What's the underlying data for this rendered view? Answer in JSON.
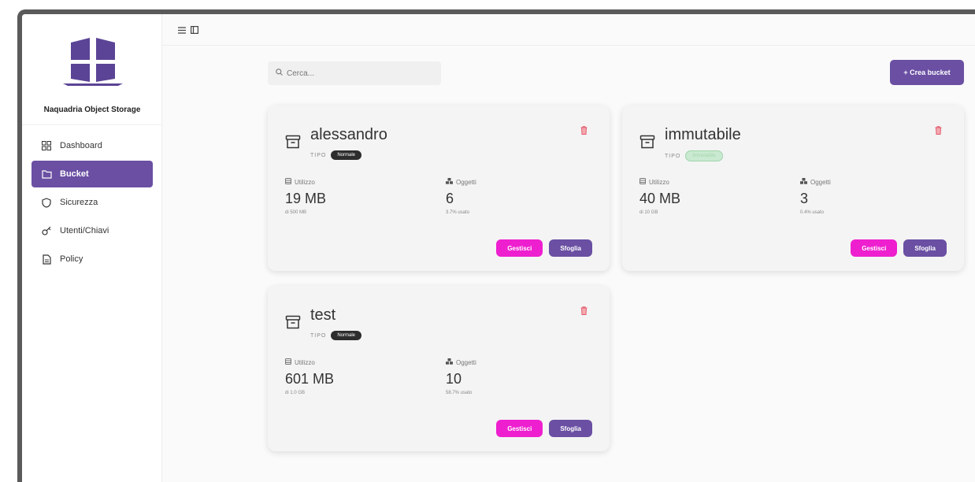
{
  "sidebar": {
    "brand": "Naquadria Object Storage",
    "items": [
      {
        "label": "Dashboard",
        "icon": "dashboard-icon"
      },
      {
        "label": "Bucket",
        "icon": "folder-icon",
        "active": true
      },
      {
        "label": "Sicurezza",
        "icon": "shield-icon"
      },
      {
        "label": "Utenti/Chiavi",
        "icon": "key-icon"
      },
      {
        "label": "Policy",
        "icon": "document-icon"
      }
    ]
  },
  "toolbar": {
    "search_placeholder": "Cerca...",
    "create_label": "+ Crea bucket"
  },
  "labels": {
    "tipo": "TIPO",
    "utilizzo": "Utilizzo",
    "oggetti": "Oggetti",
    "gestisci": "Gestisci",
    "sfoglia": "Sfoglia"
  },
  "buckets": [
    {
      "name": "alessandro",
      "type": "Normale",
      "usage": "19 MB",
      "usage_of": "di 500 MB",
      "objects": "6",
      "objects_sub": "3.7% usato"
    },
    {
      "name": "immutabile",
      "type": "Immutabile",
      "usage": "40 MB",
      "usage_of": "di 10 GB",
      "objects": "3",
      "objects_sub": "0.4% usato"
    },
    {
      "name": "test",
      "type": "Normale",
      "usage": "601 MB",
      "usage_of": "di 1.0 GB",
      "objects": "10",
      "objects_sub": "58.7% usato"
    }
  ],
  "colors": {
    "accent": "#6a4fa3",
    "pink": "#ee1fcf",
    "danger": "#e25c6b"
  }
}
